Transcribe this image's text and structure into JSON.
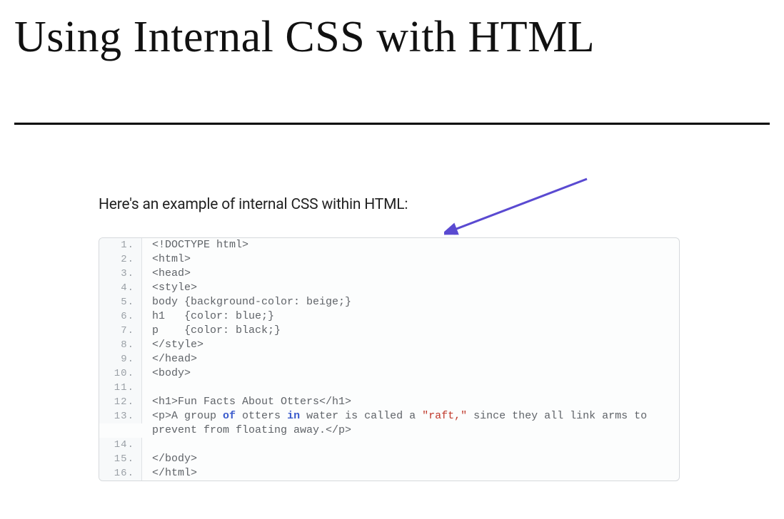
{
  "title": "Using Internal CSS with HTML",
  "intro": "Here's an example of internal CSS within HTML:",
  "arrow": {
    "color": "#5a4ad1"
  },
  "code": {
    "line_numbers": [
      "1.",
      "2.",
      "3.",
      "4.",
      "5.",
      "6.",
      "7.",
      "8.",
      "9.",
      "10.",
      "11.",
      "12.",
      "13.",
      "14.",
      "15.",
      "16."
    ],
    "lines": {
      "l1": "<!DOCTYPE html>",
      "l2": "<html>",
      "l3": "<head>",
      "l4": "<style>",
      "l5": "body {background-color: beige;}",
      "l6_pre": "h1   {color: blue;}",
      "l7_pre": "p    {color: black;}",
      "l8": "</style>",
      "l9": "</head>",
      "l10": "<body>",
      "l11": "",
      "l12": "<h1>Fun Facts About Otters</h1>",
      "l13_a": "<p>A group ",
      "l13_kw1": "of",
      "l13_b": " otters ",
      "l13_kw2": "in",
      "l13_c": " water is called a ",
      "l13_str": "\"raft,\"",
      "l13_d": " since they all link arms to prevent from floating away.</p>",
      "l14": "",
      "l15": "</body>",
      "l16": "</html>"
    }
  }
}
